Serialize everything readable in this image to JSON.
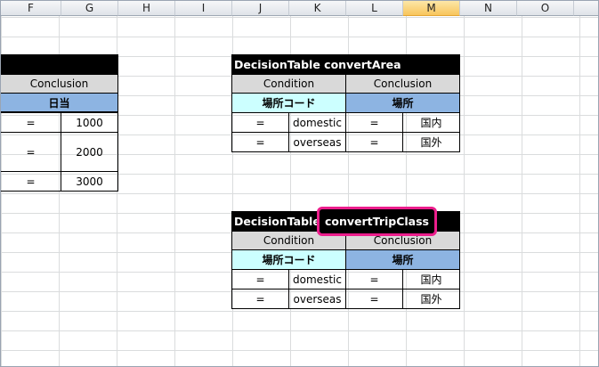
{
  "columns": [
    "F",
    "G",
    "H",
    "I",
    "J",
    "K",
    "L",
    "M",
    "N",
    "O"
  ],
  "selected_column": "M",
  "left_table": {
    "header": "Conclusion",
    "subheader": "日当",
    "rows": [
      {
        "op": "=",
        "value": "1000"
      },
      {
        "op": "=",
        "value": "2000"
      },
      {
        "op": "=",
        "value": "3000"
      }
    ]
  },
  "table1": {
    "title": "DecisionTable convertArea",
    "condition_label": "Condition",
    "conclusion_label": "Conclusion",
    "condition_field": "場所コード",
    "conclusion_field": "場所",
    "rows": [
      {
        "op1": "=",
        "val1": "domestic",
        "op2": "=",
        "val2": "国内"
      },
      {
        "op1": "=",
        "val1": "overseas",
        "op2": "=",
        "val2": "国外"
      }
    ]
  },
  "table2": {
    "title_prefix": "DecisionTable",
    "title_name": "convertTripClass",
    "condition_label": "Condition",
    "conclusion_label": "Conclusion",
    "condition_field": "場所コード",
    "conclusion_field": "場所",
    "rows": [
      {
        "op1": "=",
        "val1": "domestic",
        "op2": "=",
        "val2": "国内"
      },
      {
        "op1": "=",
        "val1": "overseas",
        "op2": "=",
        "val2": "国外"
      }
    ]
  },
  "colors": {
    "highlight_border": "#ec1e8c",
    "condition_field_bg": "#ccffff",
    "conclusion_field_bg": "#8db4e2"
  }
}
